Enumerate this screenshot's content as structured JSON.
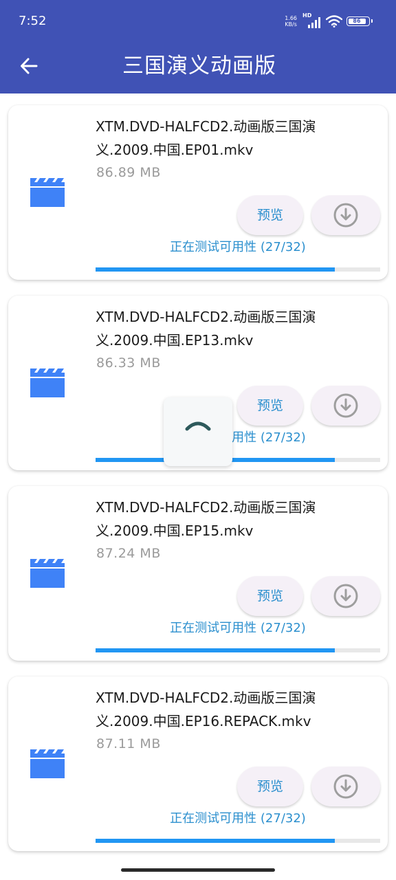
{
  "status_bar": {
    "time": "7:52",
    "net_speed_value": "1.66",
    "net_speed_unit": "KB/s",
    "network_type": "HD",
    "battery": "86"
  },
  "header": {
    "title": "三国演义动画版"
  },
  "files": [
    {
      "name": "XTM.DVD-HALFCD2.动画版三国演义.2009.中国.EP01.mkv",
      "size": "86.89 MB",
      "preview_label": "预览",
      "status": "正在测试可用性 (27/32)",
      "progress": 0.84
    },
    {
      "name": "XTM.DVD-HALFCD2.动画版三国演义.2009.中国.EP13.mkv",
      "size": "86.33 MB",
      "preview_label": "预览",
      "status": "正在测试可用性 (27/32)",
      "progress": 0.84
    },
    {
      "name": "XTM.DVD-HALFCD2.动画版三国演义.2009.中国.EP15.mkv",
      "size": "87.24 MB",
      "preview_label": "预览",
      "status": "正在测试可用性 (27/32)",
      "progress": 0.84
    },
    {
      "name": "XTM.DVD-HALFCD2.动画版三国演义.2009.中国.EP16.REPACK.mkv",
      "size": "87.11 MB",
      "preview_label": "预览",
      "status": "正在测试可用性 (27/32)",
      "progress": 0.84
    }
  ],
  "icons": {
    "back": "arrow-back-icon",
    "file": "video-clapperboard-icon",
    "download": "download-circle-icon",
    "loading": "loading-spinner-icon",
    "wifi": "wifi-icon",
    "signal": "cellular-signal-icon",
    "battery": "battery-icon"
  },
  "colors": {
    "appbar": "#4052b5",
    "accent": "#2b8fce",
    "progress": "#2196f3",
    "file_icon": "#3f82f7",
    "button_bg": "#f5f0f7",
    "spinner": "#2e5a5c"
  }
}
